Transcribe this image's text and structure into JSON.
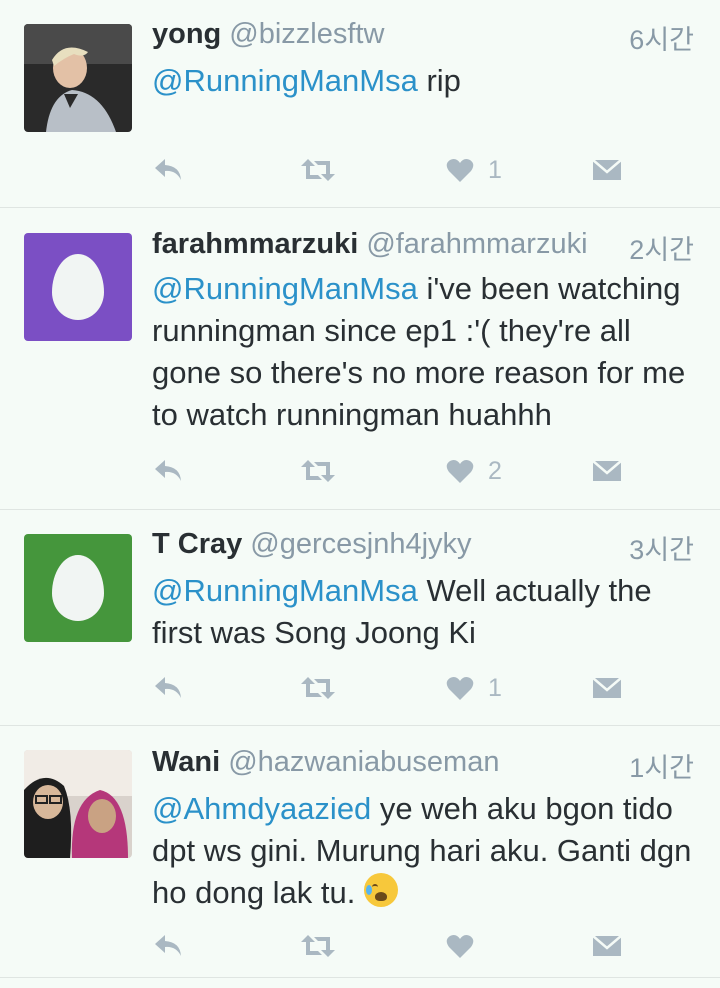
{
  "tweets": [
    {
      "name": "yong",
      "handle": "@bizzlesftw",
      "time": "6시간",
      "mention": "@RunningManMsa",
      "text": " rip",
      "likes": "1",
      "avatar": "photo"
    },
    {
      "name": "farahmmarzuki",
      "handle": "@farahmmarzuki",
      "time": "2시간",
      "mention": "@RunningManMsa",
      "text": " i've been watching runningman since ep1 :'( they're all gone so there's no more reason for me to watch runningman huahhh",
      "likes": "2",
      "avatar": "egg",
      "avatar_color": "#7b4fc4"
    },
    {
      "name": "T Cray",
      "handle": "@gercesjnh4jyky",
      "time": "3시간",
      "mention": "@RunningManMsa",
      "text": " Well actually the first was Song Joong Ki",
      "likes": "1",
      "avatar": "egg",
      "avatar_color": "#45963c"
    },
    {
      "name": "Wani",
      "handle": "@hazwaniabuseman",
      "time": "1시간",
      "mention": "@Ahmdyaazied",
      "text": " ye weh aku bgon tido dpt ws gini. Murung hari aku. Ganti dgn ho dong lak tu. ",
      "likes": "",
      "avatar": "photo",
      "emoji": "crying-face"
    }
  ],
  "icons": [
    "reply-icon",
    "retweet-icon",
    "heart-icon",
    "direct-message-icon"
  ],
  "colors": {
    "background": "#f5fbf7",
    "mention": "#2b91c9",
    "muted": "#8899a6",
    "icon": "#aab8c2"
  }
}
